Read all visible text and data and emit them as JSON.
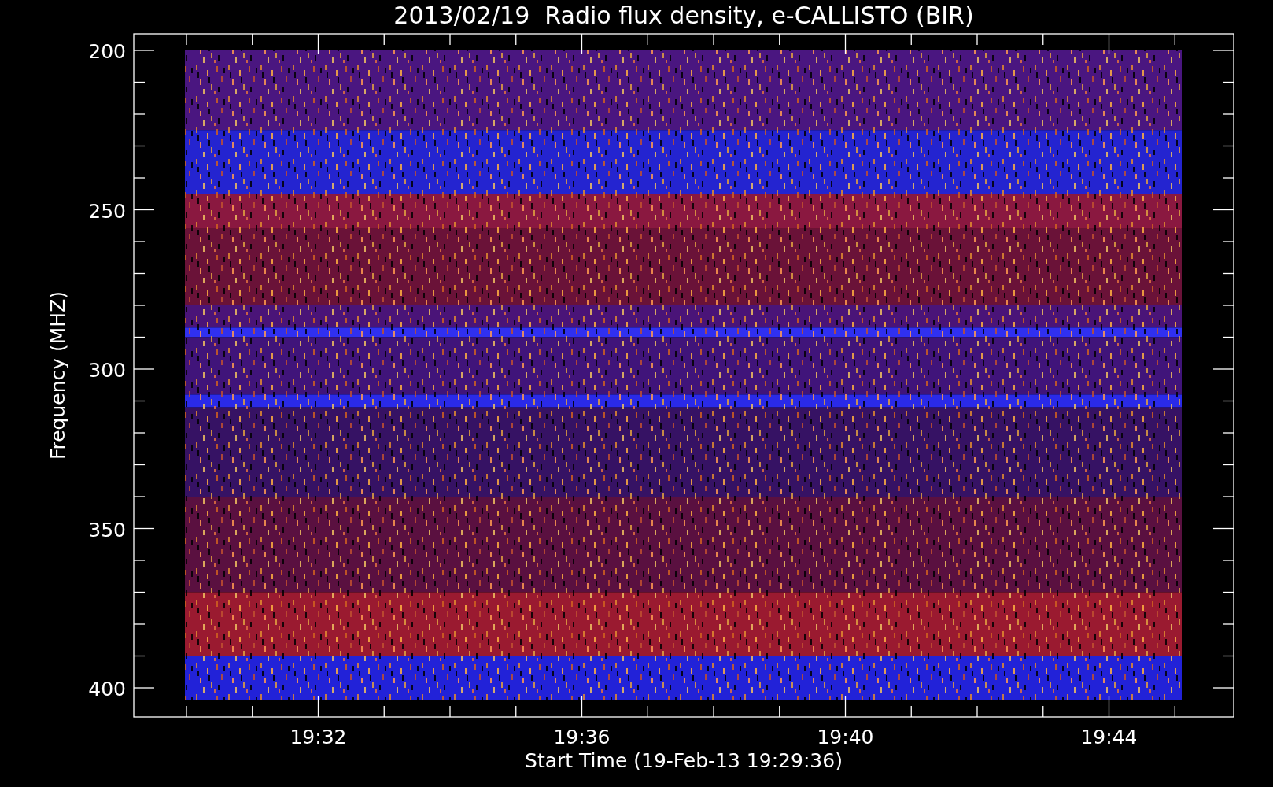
{
  "title": "2013/02/19  Radio flux density, e-CALLISTO (BIR)",
  "y_axis": {
    "label": "Frequency (MHZ)",
    "ticks": [
      "200",
      "250",
      "300",
      "350",
      "400"
    ]
  },
  "x_axis": {
    "label": "Start Time (19-Feb-13 19:29:36)",
    "ticks": [
      "19:32",
      "19:36",
      "19:40",
      "19:44"
    ]
  }
}
